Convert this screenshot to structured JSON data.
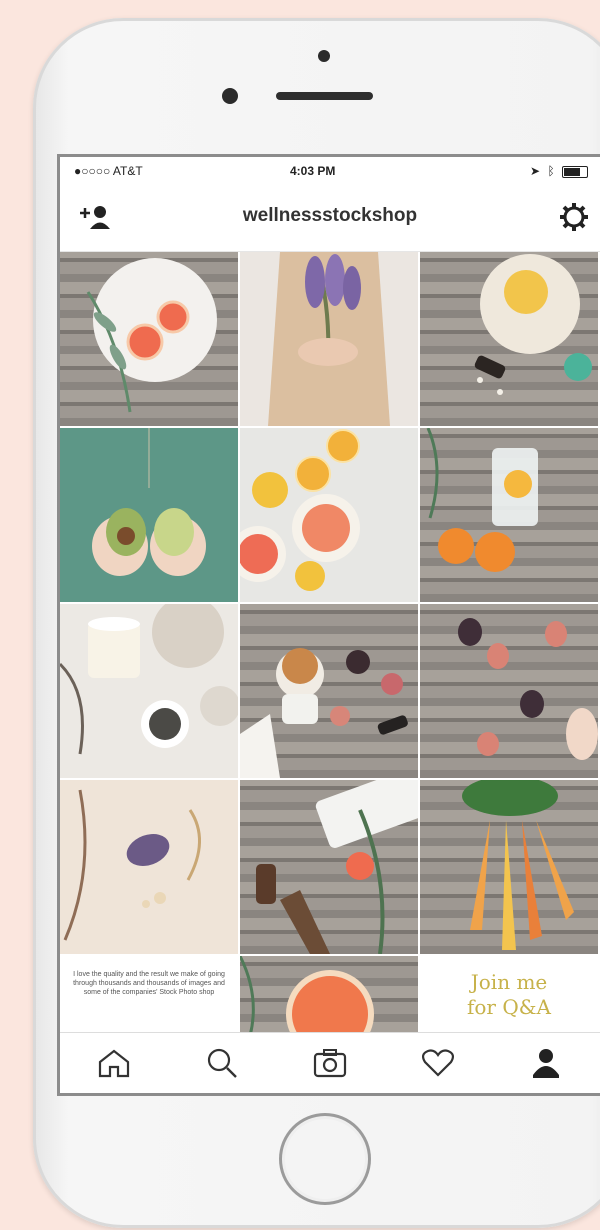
{
  "status_bar": {
    "carrier": "●○○○○ AT&T",
    "time": "4:03 PM"
  },
  "profile": {
    "username": "wellnessstockshop"
  },
  "grid": {
    "tiles": [
      {
        "kind": "photo",
        "icon": "grapefruit-plate-image"
      },
      {
        "kind": "photo",
        "icon": "lavender-bouquet-image"
      },
      {
        "kind": "photo",
        "icon": "granola-bowl-image"
      },
      {
        "kind": "photo",
        "icon": "avocado-hands-image"
      },
      {
        "kind": "photo",
        "icon": "citrus-slices-image"
      },
      {
        "kind": "photo",
        "icon": "orange-water-image"
      },
      {
        "kind": "photo",
        "icon": "candle-tea-image"
      },
      {
        "kind": "photo",
        "icon": "figs-yogurt-image"
      },
      {
        "kind": "photo",
        "icon": "figs-table-image"
      },
      {
        "kind": "photo",
        "icon": "crystal-sage-image"
      },
      {
        "kind": "photo",
        "icon": "keyboard-flatlay-image"
      },
      {
        "kind": "photo",
        "icon": "carrots-image"
      },
      {
        "kind": "quote",
        "text": "I love the quality and the result we make of going through thousands and thousands of images and some of the companies' Stock Photo shop"
      },
      {
        "kind": "photo",
        "icon": "grapefruit-half-image"
      },
      {
        "kind": "text",
        "line1": "Join me",
        "line2": "for Q&A"
      }
    ]
  },
  "tabbar": {
    "items": [
      "home-icon",
      "search-icon",
      "camera-icon",
      "heart-icon",
      "profile-icon"
    ]
  },
  "colors": {
    "accent": "#c7b24a",
    "background": "#fbe6de"
  }
}
